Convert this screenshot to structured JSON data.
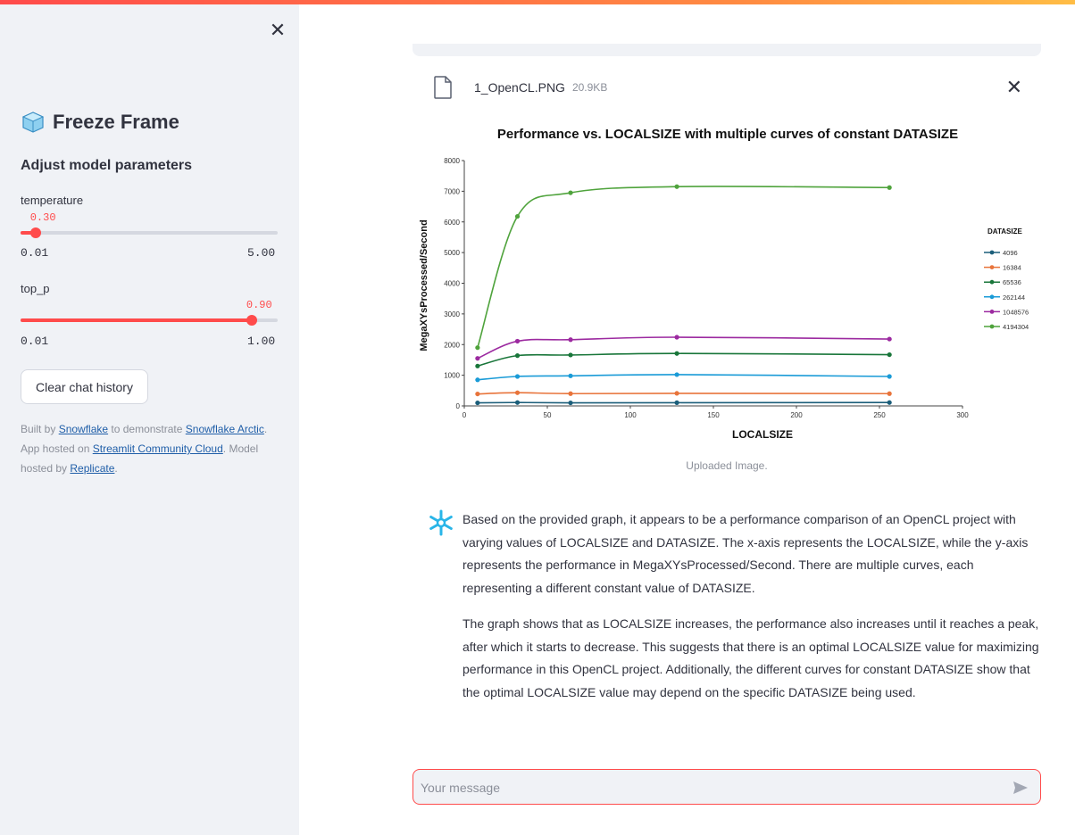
{
  "sidebar": {
    "title": "Freeze Frame",
    "heading": "Adjust model parameters",
    "temperature": {
      "label": "temperature",
      "value": 0.3,
      "value_text": "0.30",
      "min": 0.01,
      "max": 5.0,
      "min_text": "0.01",
      "max_text": "5.00"
    },
    "top_p": {
      "label": "top_p",
      "value": 0.9,
      "value_text": "0.90",
      "min": 0.01,
      "max": 1.0,
      "min_text": "0.01",
      "max_text": "1.00"
    },
    "clear_button": "Clear chat history",
    "credits": {
      "built_by": "Built by ",
      "snowflake": "Snowflake",
      "to_demo": " to demonstrate ",
      "snowflake_arctic": "Snowflake Arctic",
      "hosted_on": ". App hosted on ",
      "streamlit": "Streamlit Community Cloud",
      "model_hosted": ". Model hosted by ",
      "replicate": "Replicate",
      "end": "."
    }
  },
  "file": {
    "name": "1_OpenCL.PNG",
    "size": "20.9KB"
  },
  "caption": "Uploaded Image.",
  "message": {
    "p1": "Based on the provided graph, it appears to be a performance comparison of an OpenCL project with varying values of LOCALSIZE and DATASIZE. The x-axis represents the LOCALSIZE, while the y-axis represents the performance in MegaXYsProcessed/Second. There are multiple curves, each representing a different constant value of DATASIZE.",
    "p2": "The graph shows that as LOCALSIZE increases, the performance also increases until it reaches a peak, after which it starts to decrease. This suggests that there is an optimal LOCALSIZE value for maximizing performance in this OpenCL project. Additionally, the different curves for constant DATASIZE show that the optimal LOCALSIZE value may depend on the specific DATASIZE being used."
  },
  "input": {
    "placeholder": "Your message"
  },
  "colors": {
    "accent": "#ff4b4b",
    "link": "#1f5ea8",
    "sidebar_bg": "#f0f2f6"
  },
  "chart_data": {
    "type": "line",
    "title": "Performance vs. LOCALSIZE with multiple curves of constant DATASIZE",
    "xlabel": "LOCALSIZE",
    "ylabel": "MegaXYsProcessed/Second",
    "xlim": [
      0,
      300
    ],
    "ylim": [
      0,
      8000
    ],
    "xticks": [
      0,
      50,
      100,
      150,
      200,
      250,
      300
    ],
    "yticks": [
      0,
      1000,
      2000,
      3000,
      4000,
      5000,
      6000,
      7000,
      8000
    ],
    "legend_title": "DATASIZE",
    "legend_position": "right",
    "x": [
      8,
      32,
      64,
      128,
      256
    ],
    "series": [
      {
        "name": "4096",
        "color": "#1b5e7a",
        "values": [
          100,
          110,
          100,
          105,
          110
        ]
      },
      {
        "name": "16384",
        "color": "#e8743b",
        "values": [
          390,
          430,
          400,
          410,
          400
        ]
      },
      {
        "name": "65536",
        "color": "#19763a",
        "values": [
          1300,
          1640,
          1660,
          1710,
          1670
        ]
      },
      {
        "name": "262144",
        "color": "#1a9bd7",
        "values": [
          850,
          960,
          980,
          1020,
          960
        ]
      },
      {
        "name": "1048576",
        "color": "#9c2aa0",
        "values": [
          1550,
          2110,
          2160,
          2240,
          2180
        ]
      },
      {
        "name": "4194304",
        "color": "#4fa33c",
        "values": [
          1900,
          6180,
          6950,
          7150,
          7120
        ]
      }
    ]
  }
}
